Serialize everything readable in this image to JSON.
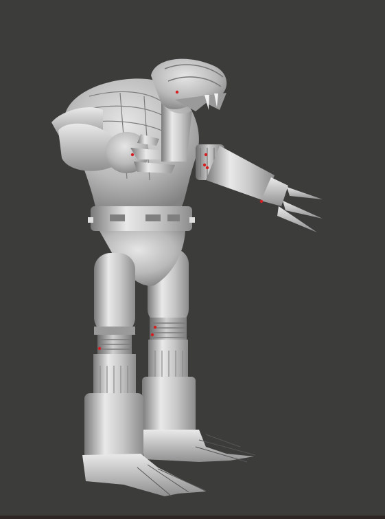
{
  "viewport": {
    "background": "#3c3c3b",
    "model_name": "robot-cobra-figure",
    "marker_color": "#d42020"
  }
}
